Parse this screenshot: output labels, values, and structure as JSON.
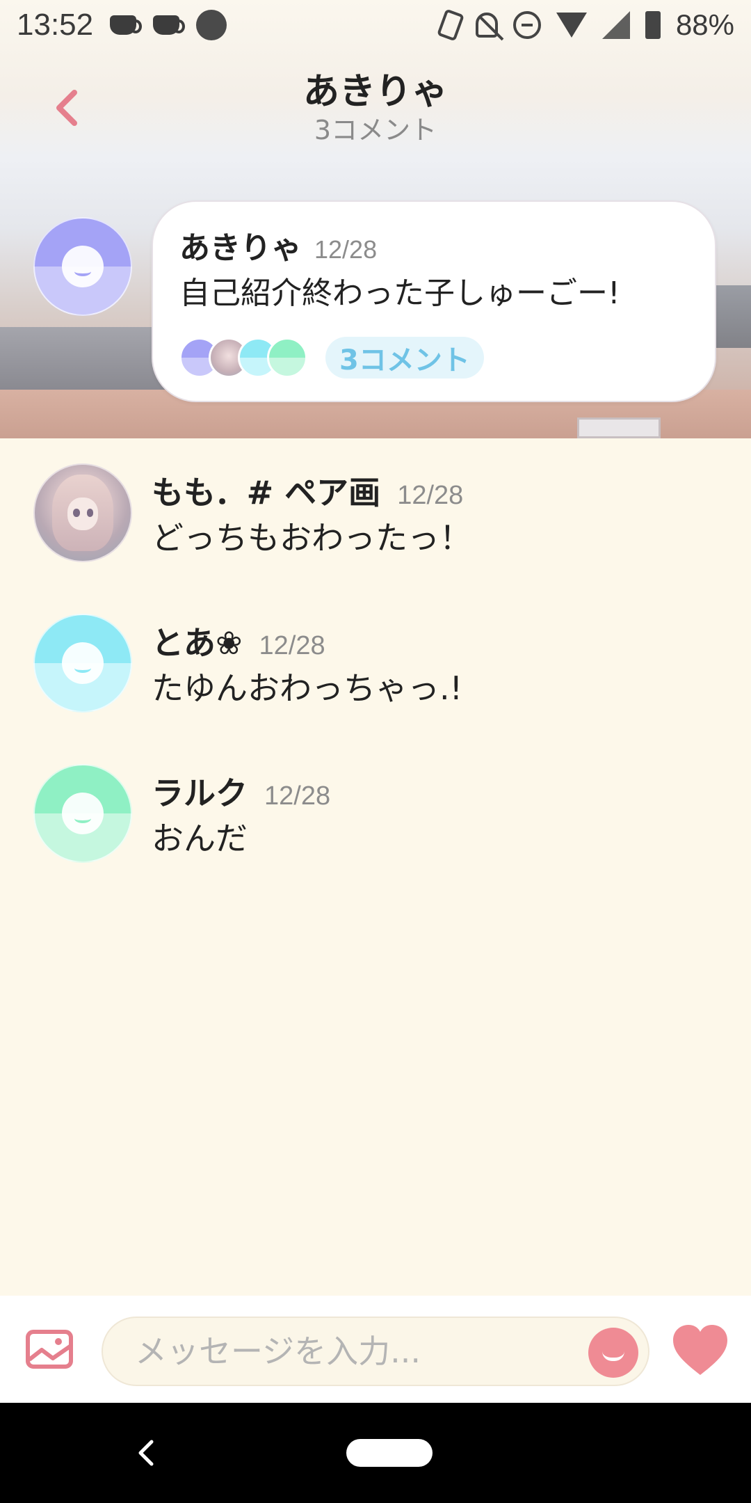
{
  "status_bar": {
    "time": "13:52",
    "battery": "88%"
  },
  "header": {
    "title": "あきりゃ",
    "subtitle": "3コメント"
  },
  "parent_post": {
    "author": "あきりゃ",
    "date": "12/28",
    "text": "自己紹介終わった子しゅーごー!",
    "comment_chip": "3コメント",
    "avatar_color": "#a7a6f5"
  },
  "comments": [
    {
      "author": "もも．# ペア画",
      "date": "12/28",
      "text": "どっちもおわったっ！",
      "avatar": "photo"
    },
    {
      "author": "とあ❀",
      "date": "12/28",
      "text": "たゆんおわっちゃっ.!",
      "avatar_color": "#8ee9f5"
    },
    {
      "author": "ラルク",
      "date": "12/28",
      "text": "おんだ",
      "avatar_color": "#8ff0c4"
    }
  ],
  "composer": {
    "placeholder": "メッセージを入力..."
  },
  "colors": {
    "accent_pink": "#ef8b94",
    "chip_blue": "#6fc3e6",
    "background": "#fdf8ea"
  },
  "icons": {
    "back": "chevron-left-icon",
    "image": "image-icon",
    "emoji": "smiley-icon",
    "heart": "heart-icon"
  }
}
